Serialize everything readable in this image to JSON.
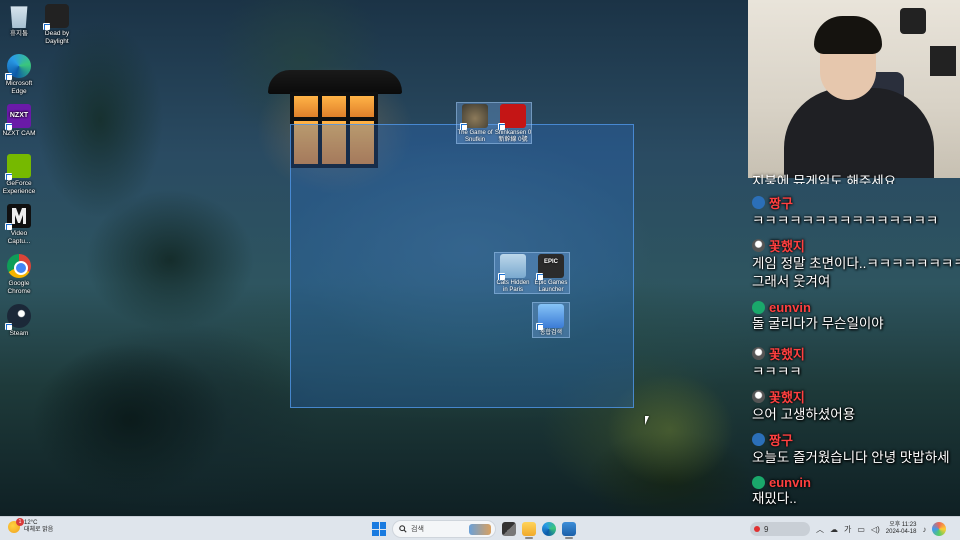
{
  "desktop": {
    "left_icons": [
      {
        "label": "휴지통",
        "icon": "recycle-bin-icon"
      },
      {
        "label": "Dead by Daylight",
        "icon": "dead-by-daylight-icon"
      },
      {
        "label": "Microsoft Edge",
        "icon": "edge-icon"
      },
      {
        "label": "NZXT CAM",
        "icon": "nzxt-cam-icon"
      },
      {
        "label": "GeForce Experience",
        "icon": "geforce-icon"
      },
      {
        "label": "Video Captu...",
        "icon": "video-capture-icon"
      },
      {
        "label": "Google Chrome",
        "icon": "chrome-icon"
      },
      {
        "label": "Steam",
        "icon": "steam-icon"
      }
    ],
    "nzxt_logo_text": "NZXT",
    "epic_logo_text": "EPIC",
    "selected_icons": [
      {
        "label": "The Game of Snufkin",
        "icon": "snufkin-game-icon"
      },
      {
        "label": "Shinkansen 0 新幹線 0號",
        "icon": "shinkansen-icon"
      },
      {
        "label": "Cats Hidden in Paris",
        "icon": "cats-hidden-icon"
      },
      {
        "label": "Epic Games Launcher",
        "icon": "epic-games-icon"
      },
      {
        "label": "통합검색",
        "icon": "app-shortcut-icon"
      }
    ]
  },
  "chat": {
    "partial_top": "지붕에 뮤게임도 해주세요",
    "messages": [
      {
        "user": "짱구",
        "avatar": "blue-badge",
        "text": "ㅋㅋㅋㅋㅋㅋㅋㅋㅋㅋㅋㅋㅋㅋㅋ"
      },
      {
        "user": "꽃했지",
        "avatar": "face",
        "text": "게임 정말 초면이다..ㅋㅋㅋㅋㅋㅋㅋㅋ",
        "text2": "그래서 웃겨여"
      },
      {
        "user": "eunvin",
        "avatar": "green-badge",
        "text": "돌 굴리다가 무슨일이야"
      },
      {
        "user": "꽃했지",
        "avatar": "face",
        "text": "ㅋㅋㅋㅋ"
      },
      {
        "user": "꽃했지",
        "avatar": "face",
        "text": "으어 고생하셨어용"
      },
      {
        "user": "짱구",
        "avatar": "blue-badge",
        "text": "오늘도 즐거웠습니다 안녕 맛밥하세"
      },
      {
        "user": "eunvin",
        "avatar": "green-badge",
        "text": "재밌다.."
      }
    ]
  },
  "taskbar": {
    "weather_temp": "12°C",
    "weather_desc": "대체로 맑음",
    "weather_badge": "1",
    "search_placeholder": "검색",
    "tray_count": "9",
    "ime": "가",
    "time": "오후 11:23",
    "date": "2024-04-18"
  },
  "colors": {
    "chat_name": "#ff4040",
    "selection": "#2870c8",
    "taskbar": "#dfe5ec"
  }
}
